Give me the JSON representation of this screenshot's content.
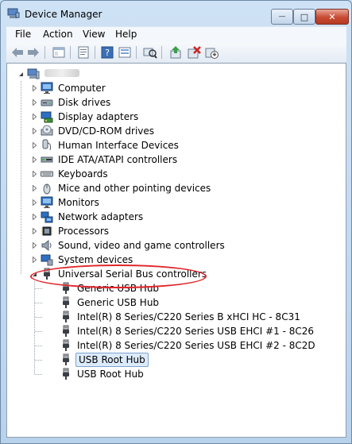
{
  "window": {
    "title": "Device Manager",
    "minimize_glyph": "—",
    "maximize_glyph": "□",
    "close_glyph": "✕"
  },
  "menu": [
    {
      "label": "File"
    },
    {
      "label": "Action"
    },
    {
      "label": "View"
    },
    {
      "label": "Help"
    }
  ],
  "toolbar": [
    {
      "icon": "back-arrow-icon"
    },
    {
      "icon": "forward-arrow-icon"
    },
    {
      "icon": "show-hide-console-tree-icon"
    },
    {
      "icon": "properties-icon"
    },
    {
      "icon": "help-icon"
    },
    {
      "icon": "show-hidden-devices-icon"
    },
    {
      "icon": "scan-hardware-changes-icon"
    },
    {
      "icon": "update-driver-icon"
    },
    {
      "icon": "uninstall-device-icon"
    },
    {
      "icon": "disable-device-icon"
    }
  ],
  "tree": {
    "root": {
      "label": "",
      "icon": "computer-icon",
      "expanded": true
    },
    "categories": [
      {
        "label": "Computer",
        "icon": "monitor-icon"
      },
      {
        "label": "Disk drives",
        "icon": "disk-drive-icon"
      },
      {
        "label": "Display adapters",
        "icon": "display-adapter-icon"
      },
      {
        "label": "DVD/CD-ROM drives",
        "icon": "dvd-drive-icon"
      },
      {
        "label": "Human Interface Devices",
        "icon": "hid-icon"
      },
      {
        "label": "IDE ATA/ATAPI controllers",
        "icon": "ide-controller-icon"
      },
      {
        "label": "Keyboards",
        "icon": "keyboard-icon"
      },
      {
        "label": "Mice and other pointing devices",
        "icon": "mouse-icon"
      },
      {
        "label": "Monitors",
        "icon": "monitor-icon"
      },
      {
        "label": "Network adapters",
        "icon": "network-adapter-icon"
      },
      {
        "label": "Processors",
        "icon": "processor-icon"
      },
      {
        "label": "Sound, video and game controllers",
        "icon": "speaker-icon"
      },
      {
        "label": "System devices",
        "icon": "system-devices-icon"
      }
    ],
    "expanded_category": {
      "label": "Universal Serial Bus controllers",
      "icon": "usb-plug-icon",
      "highlight_color": "#e0262a",
      "children": [
        {
          "label": "Generic USB Hub",
          "icon": "usb-plug-icon",
          "selected": false
        },
        {
          "label": "Generic USB Hub",
          "icon": "usb-plug-icon",
          "selected": false
        },
        {
          "label": "Intel(R) 8 Series/C220 Series  B xHCI HC - 8C31",
          "icon": "usb-plug-icon",
          "selected": false
        },
        {
          "label": "Intel(R) 8 Series/C220 Series  USB EHCI #1 - 8C26",
          "icon": "usb-plug-icon",
          "selected": false
        },
        {
          "label": "Intel(R) 8 Series/C220 Series  USB EHCI #2 - 8C2D",
          "icon": "usb-plug-icon",
          "selected": false
        },
        {
          "label": "USB Root Hub",
          "icon": "usb-plug-icon",
          "selected": true
        },
        {
          "label": "USB Root Hub",
          "icon": "usb-plug-icon",
          "selected": false
        }
      ]
    }
  },
  "colors": {
    "selection_bg": "#dcebfc",
    "selection_border": "#7da2ce",
    "highlight": "#e0262a"
  }
}
